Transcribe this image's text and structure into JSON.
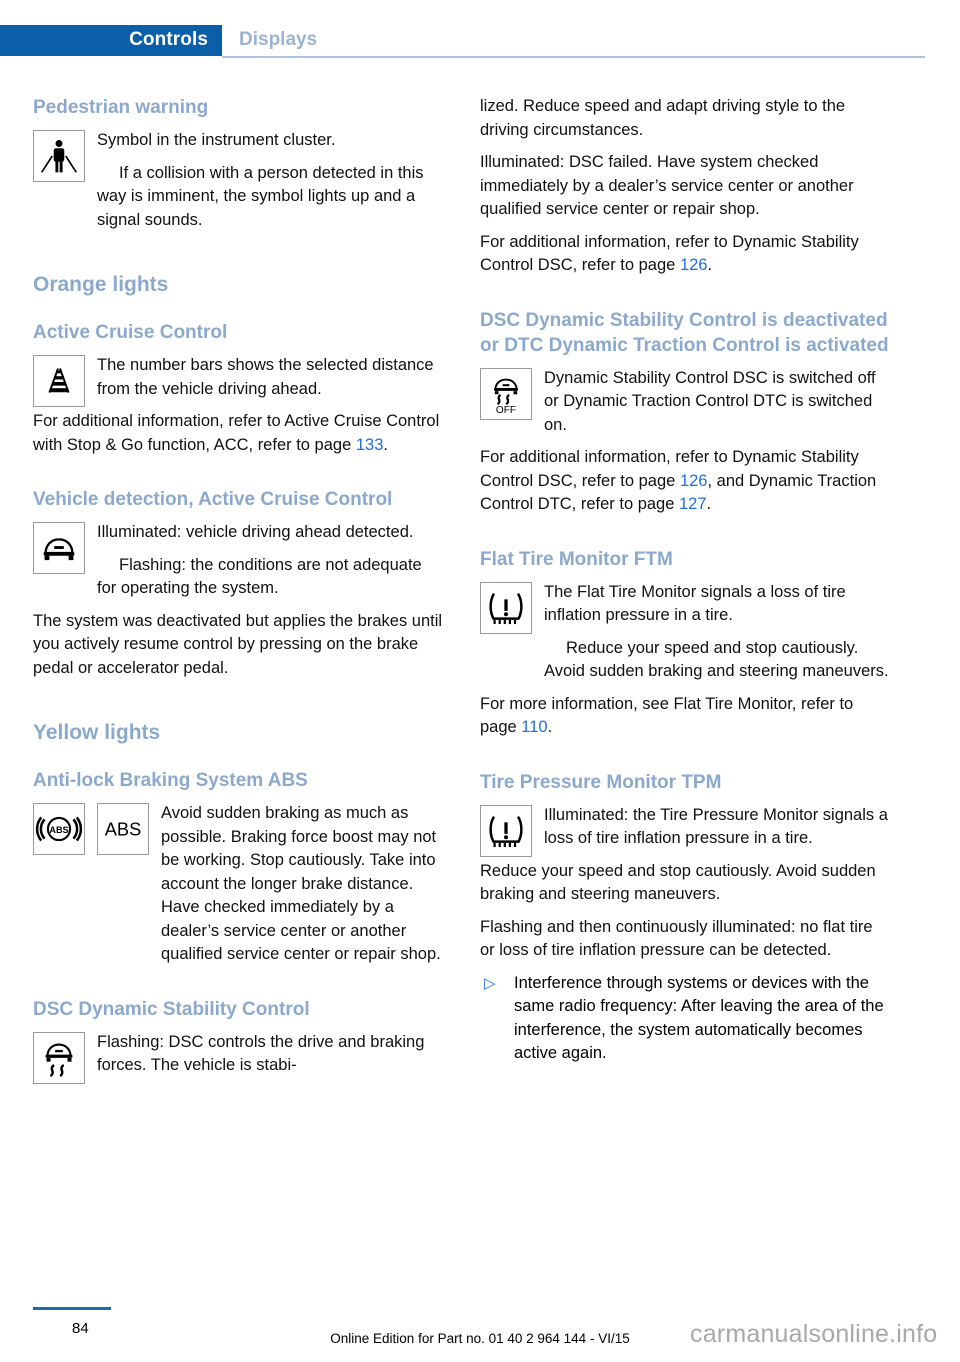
{
  "header": {
    "active_tab": "Controls",
    "inactive_tab": "Displays"
  },
  "left_column": {
    "pedestrian": {
      "heading": "Pedestrian warning",
      "icon": "pedestrian-warning-icon",
      "p1": "Symbol in the instrument cluster.",
      "p2": "If a collision with a person detected in this way is imminent, the symbol lights up and a signal sounds."
    },
    "orange_lights_heading": "Orange lights",
    "acc": {
      "heading": "Active Cruise Control",
      "icon": "acc-distance-bars-icon",
      "p1": "The number bars shows the selected distance from the vehicle driving ahead.",
      "p2_a": "For additional information, refer to Active Cruise Control with Stop & Go function, ACC, refer to page ",
      "p2_page": "133",
      "p2_b": "."
    },
    "vehicle_detection": {
      "heading": "Vehicle detection, Active Cruise Control",
      "icon": "vehicle-front-icon",
      "p1": "Illuminated: vehicle driving ahead detected.",
      "p2": "Flashing: the conditions are not adequate for operating the system.",
      "p3": "The system was deactivated but applies the brakes until you actively resume control by pressing on the brake pedal or accelerator pedal."
    },
    "yellow_lights_heading": "Yellow lights",
    "abs": {
      "heading": "Anti-lock Braking System ABS",
      "icon1": "abs-circle-icon",
      "icon2": "abs-text-icon",
      "icon2_label": "ABS",
      "p1": "Avoid sudden braking as much as possible. Braking force boost may not be working. Stop cautiously. Take into account the longer brake distance. Have checked immediately by a dealer’s service center or another qualified service center or repair shop."
    },
    "dsc": {
      "heading": "DSC Dynamic Stability Control",
      "icon": "dsc-skid-icon",
      "p1": "Flashing: DSC controls the drive and braking forces. The vehicle is stabi-"
    }
  },
  "right_column": {
    "dsc_cont": {
      "p1": "lized. Reduce speed and adapt driving style to the driving circumstances.",
      "p2": "Illuminated: DSC failed. Have system checked immediately by a dealer’s service center or another qualified service center or repair shop.",
      "p3_a": "For additional information, refer to Dynamic Stability Control DSC, refer to page ",
      "p3_page": "126",
      "p3_b": "."
    },
    "dsc_off": {
      "heading": "DSC Dynamic Stability Control is deactivated or DTC Dynamic Traction Control is activated",
      "icon": "dsc-off-icon",
      "icon_label": "OFF",
      "p1": "Dynamic Stability Control DSC is switched off or Dynamic Traction Control DTC is switched on.",
      "p2_a": "For additional information, refer to Dynamic Stability Control DSC, refer to page ",
      "p2_page1": "126",
      "p2_b": ", and Dynamic Traction Control DTC, refer to page ",
      "p2_page2": "127",
      "p2_c": "."
    },
    "ftm": {
      "heading": "Flat Tire Monitor FTM",
      "icon": "tire-pressure-warning-icon",
      "p1": "The Flat Tire Monitor signals a loss of tire inflation pressure in a tire.",
      "p2": "Reduce your speed and stop cautiously. Avoid sudden braking and steering maneuvers.",
      "p3_a": "For more information, see Flat Tire Monitor, refer to page ",
      "p3_page": "110",
      "p3_b": "."
    },
    "tpm": {
      "heading": "Tire Pressure Monitor TPM",
      "icon": "tire-pressure-warning-icon",
      "p1": "Illuminated: the Tire Pressure Monitor signals a loss of tire inflation pressure in a tire.",
      "p2": "Reduce your speed and stop cautiously. Avoid sudden braking and steering maneuvers.",
      "p3": "Flashing and then continuously illuminated: no flat tire or loss of tire inflation pressure can be detected.",
      "bullet_mark": "▷",
      "bullet1": "Interference through systems or devices with the same radio frequency: After leaving the area of the interference, the system automatically becomes active again."
    }
  },
  "footer": {
    "page_number": "84",
    "edition_text": "Online Edition for Part no. 01 40 2 964 144 - VI/15",
    "watermark": "carmanualsonline.info"
  }
}
